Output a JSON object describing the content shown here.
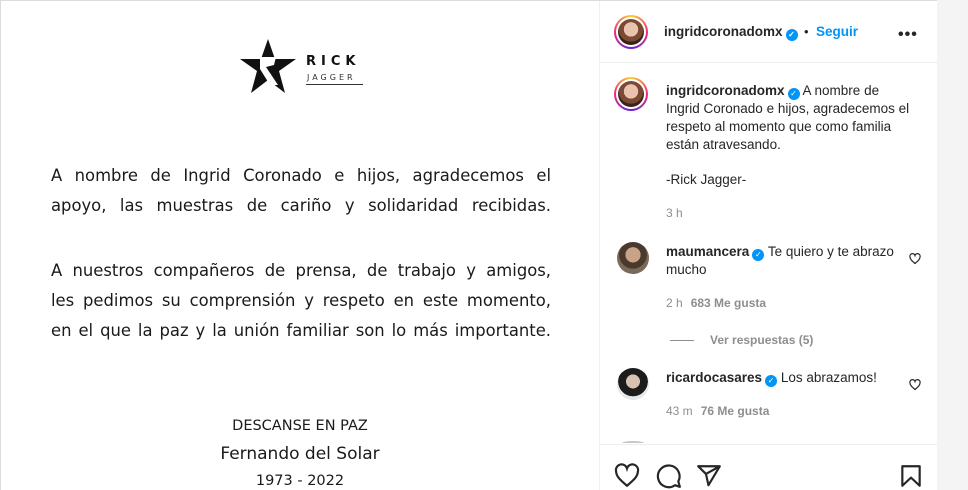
{
  "post_image": {
    "logo": {
      "line1": "RICK",
      "line2": "JAGGER",
      "icon": "star-r-logo-icon"
    },
    "paragraph1": [
      "A nombre de Ingrid Coronado e hijos, agradecemos el",
      "apoyo, las muestras de cariño y solidaridad recibidas."
    ],
    "paragraph2": [
      "A nuestros compañeros de prensa, de trabajo y amigos,",
      "les pedimos su comprensión y respeto en este momento,",
      "en el que la paz y la unión familiar son lo más importante."
    ],
    "rip": "DESCANSE EN PAZ",
    "name": "Fernando del Solar",
    "years": "1973 - 2022"
  },
  "header": {
    "username": "ingridcoronadomx",
    "separator": "•",
    "follow_label": "Seguir",
    "more_label": "•••"
  },
  "caption": {
    "username": "ingridcoronadomx",
    "text": "A nombre de Ingrid Coronado e hijos, agradecemos el respeto al momento que como familia están atravesando.",
    "signature": "-Rick Jagger-",
    "time": "3 h"
  },
  "comments": [
    {
      "username": "maumancera",
      "text": "Te quiero y te abrazo mucho",
      "time": "2 h",
      "likes": "683 Me gusta",
      "view_replies": "Ver respuestas (5)"
    },
    {
      "username": "ricardocasares",
      "text": "Los abrazamos!",
      "time": "43 m",
      "likes": "76 Me gusta"
    }
  ],
  "actions": [
    "heart-icon",
    "comment-icon",
    "share-icon",
    "bookmark-icon"
  ],
  "colors": {
    "accent": "#0095f6",
    "muted": "#8e8e8e",
    "text": "#262626"
  }
}
